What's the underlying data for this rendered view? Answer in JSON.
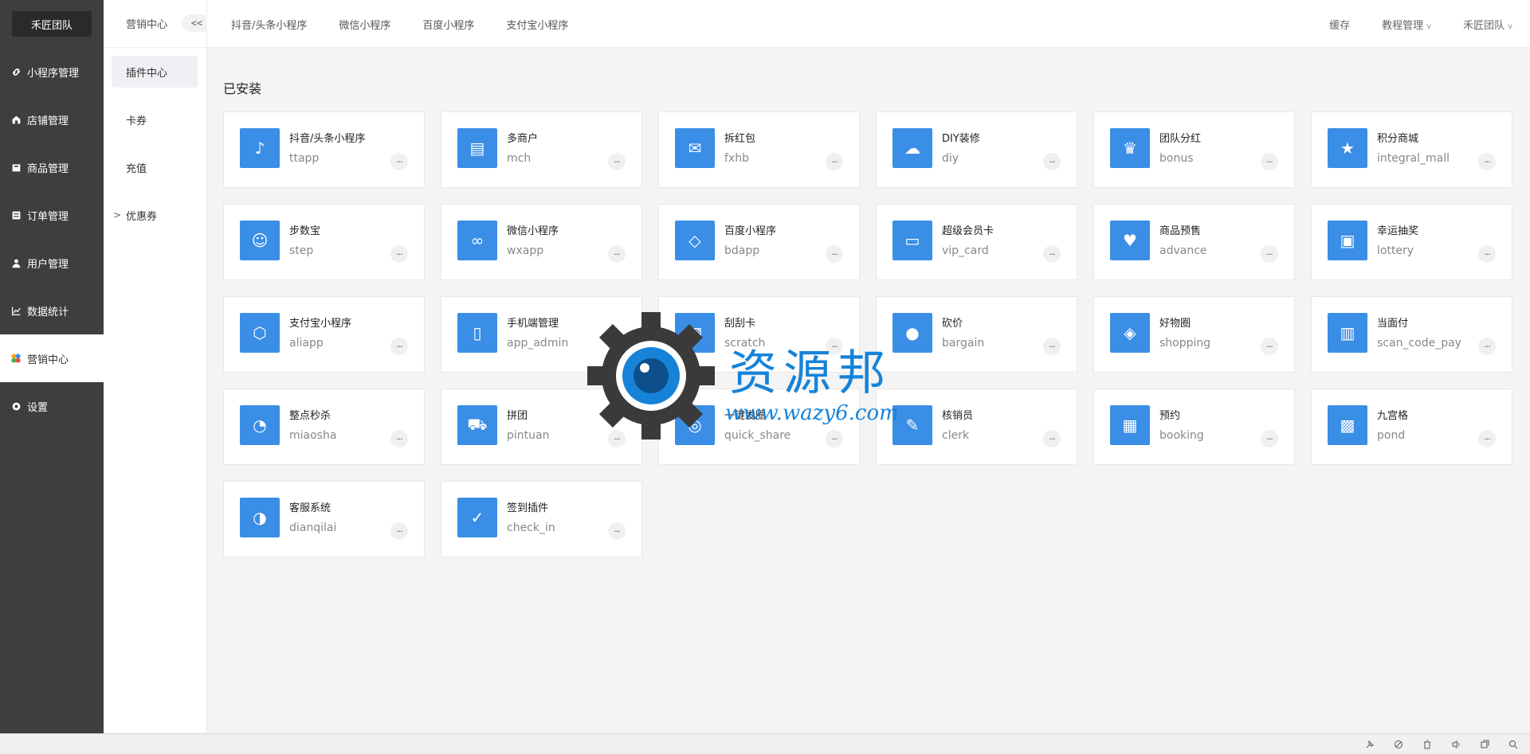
{
  "sidebar": {
    "brand": "禾匠团队",
    "items": [
      {
        "label": "小程序管理",
        "icon": "link-icon"
      },
      {
        "label": "店铺管理",
        "icon": "store-icon"
      },
      {
        "label": "商品管理",
        "icon": "box-icon"
      },
      {
        "label": "订单管理",
        "icon": "list-icon"
      },
      {
        "label": "用户管理",
        "icon": "user-icon"
      },
      {
        "label": "数据统计",
        "icon": "chart-icon"
      },
      {
        "label": "营销中心",
        "icon": "marketing-icon"
      },
      {
        "label": "设置",
        "icon": "gear-icon"
      }
    ]
  },
  "subnav": {
    "title": "营销中心",
    "collapse": "<<",
    "items": [
      "插件中心",
      "卡券",
      "充值",
      "优惠券"
    ],
    "expand_arrow": ">"
  },
  "header": {
    "tabs": [
      "抖音/头条小程序",
      "微信小程序",
      "百度小程序",
      "支付宝小程序"
    ],
    "tools": [
      "缓存",
      "教程管理",
      "禾匠团队"
    ],
    "chevron": "v"
  },
  "main": {
    "section_title": "已安装",
    "more_label": "···",
    "plugins": [
      {
        "name": "抖音/头条小程序",
        "key": "ttapp"
      },
      {
        "name": "多商户",
        "key": "mch"
      },
      {
        "name": "拆红包",
        "key": "fxhb"
      },
      {
        "name": "DIY装修",
        "key": "diy"
      },
      {
        "name": "团队分红",
        "key": "bonus"
      },
      {
        "name": "积分商城",
        "key": "integral_mall"
      },
      {
        "name": "步数宝",
        "key": "step"
      },
      {
        "name": "微信小程序",
        "key": "wxapp"
      },
      {
        "name": "百度小程序",
        "key": "bdapp"
      },
      {
        "name": "超级会员卡",
        "key": "vip_card"
      },
      {
        "name": "商品预售",
        "key": "advance"
      },
      {
        "name": "幸运抽奖",
        "key": "lottery"
      },
      {
        "name": "支付宝小程序",
        "key": "aliapp"
      },
      {
        "name": "手机端管理",
        "key": "app_admin"
      },
      {
        "name": "刮刮卡",
        "key": "scratch"
      },
      {
        "name": "砍价",
        "key": "bargain"
      },
      {
        "name": "好物圈",
        "key": "shopping"
      },
      {
        "name": "当面付",
        "key": "scan_code_pay"
      },
      {
        "name": "整点秒杀",
        "key": "miaosha"
      },
      {
        "name": "拼团",
        "key": "pintuan"
      },
      {
        "name": "一键发圈",
        "key": "quick_share"
      },
      {
        "name": "核销员",
        "key": "clerk"
      },
      {
        "name": "预约",
        "key": "booking"
      },
      {
        "name": "九宫格",
        "key": "pond"
      },
      {
        "name": "客服系统",
        "key": "dianqilai"
      },
      {
        "name": "签到插件",
        "key": "check_in"
      }
    ]
  },
  "watermark": {
    "text": "资源邦",
    "url": "www.wazy6.com"
  },
  "colors": {
    "sidebar_bg": "#3e3e3e",
    "icon_bg": "#3a8ee6",
    "watermark": "#1683d8"
  }
}
